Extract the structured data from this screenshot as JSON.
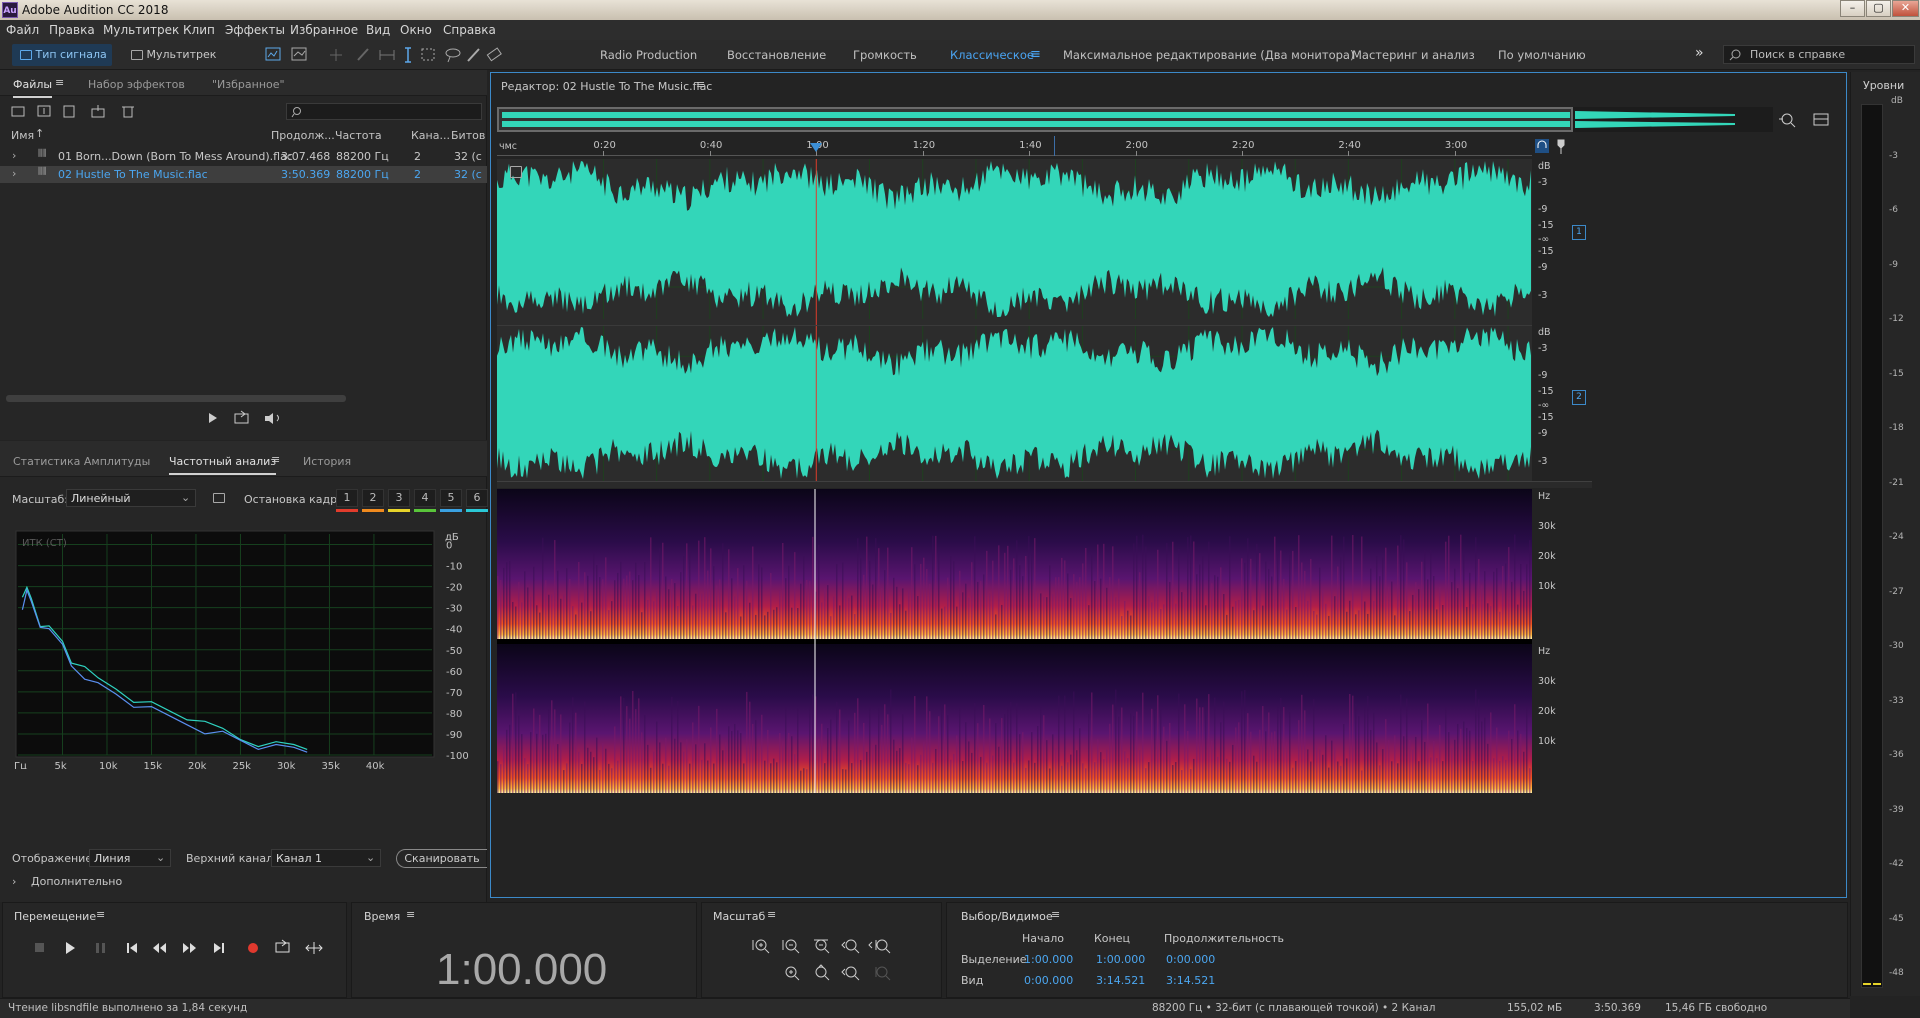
{
  "window": {
    "title": "Adobe Audition CC 2018",
    "app_icon": "Au"
  },
  "menu": [
    "Файл",
    "Правка",
    "Мультитрек",
    "Клип",
    "Эффекты",
    "Избранное",
    "Вид",
    "Окно",
    "Справка"
  ],
  "toolbar": {
    "waveform_label": "Тип сигнала",
    "multitrack_label": "Мультитрек",
    "workspaces": [
      "Radio Production",
      "Восстановление",
      "Громкость",
      "Классическое",
      "Максимальное редактирование (Два монитора)",
      "Мастеринг и анализ",
      "По умолчанию"
    ],
    "active_workspace": "Классическое",
    "help_search_placeholder": "Поиск в справке"
  },
  "files_panel": {
    "tabs": [
      "Файлы",
      "Набор эффектов",
      "\"Избранное\""
    ],
    "search_placeholder": "",
    "columns": [
      "Имя",
      "Продолж...",
      "Частота",
      "Кана...",
      "Битов"
    ],
    "rows": [
      {
        "name": "01 Born...Down (Born To Mess Around).flac",
        "duration": "3:07.468",
        "rate": "88200 Гц",
        "channels": "2",
        "bits": "32 (с"
      },
      {
        "name": "02 Hustle To The Music.flac",
        "duration": "3:50.369",
        "rate": "88200 Гц",
        "channels": "2",
        "bits": "32 (с"
      }
    ]
  },
  "analysis_panel": {
    "tabs": [
      "Статистика Амплитуды",
      "Частотный анализ",
      "История"
    ],
    "scale_label": "Масштаб:",
    "scale_value": "Линейный",
    "freeze_label": "Остановка кадра:",
    "freeze_slots": [
      "1",
      "2",
      "3",
      "4",
      "5",
      "6"
    ],
    "freeze_colors": [
      "#e23c2c",
      "#f08a1e",
      "#e6d32a",
      "#59c43a",
      "#3aa0e0",
      "#2bc8d6"
    ],
    "graph_label": "ИТК (СТ)",
    "db_unit": "дБ",
    "db_ticks": [
      "0",
      "-10",
      "-20",
      "-30",
      "-40",
      "-50",
      "-60",
      "-70",
      "-80",
      "-90",
      "-100"
    ],
    "freq_ticks": [
      "Гц",
      "5k",
      "10k",
      "15k",
      "20k",
      "25k",
      "30k",
      "35k",
      "40k"
    ],
    "display_label": "Отображение:",
    "display_value": "Линия",
    "top_channel_label": "Верхний канал:",
    "top_channel_value": "Канал 1",
    "scan_button": "Сканировать",
    "advanced_label": "Дополнительно"
  },
  "editor": {
    "title": "Редактор: 02 Hustle To The Music.flac",
    "time_unit": "чмс",
    "time_ticks": [
      "0:20",
      "0:40",
      "1:00",
      "1:20",
      "1:40",
      "2:00",
      "2:20",
      "2:40",
      "3:00"
    ],
    "playhead_position_s": 60,
    "total_duration_s": 194.5,
    "wave_db_labels": [
      "dB",
      "-3",
      "-9",
      "-15",
      "-∞",
      "-15",
      "-9",
      "-3"
    ],
    "channel_badges": [
      "1",
      "2"
    ],
    "spectral_labels": [
      "Hz",
      "30k",
      "20k",
      "10k"
    ]
  },
  "levels_panel": {
    "title": "Уровни",
    "ticks": [
      "dB",
      "-3",
      "-6",
      "-9",
      "-12",
      "-15",
      "-18",
      "-21",
      "-24",
      "-27",
      "-30",
      "-33",
      "-36",
      "-39",
      "-42",
      "-45",
      "-48"
    ]
  },
  "transport": {
    "title": "Перемещение"
  },
  "time_panel": {
    "title": "Время",
    "value": "1:00.000"
  },
  "zoom_panel": {
    "title": "Масштаб"
  },
  "selection_panel": {
    "title": "Выбор/Видимое",
    "headers": [
      "Начало",
      "Конец",
      "Продолжительность"
    ],
    "selection": {
      "label": "Выделение",
      "start": "1:00.000",
      "end": "1:00.000",
      "duration": "0:00.000"
    },
    "view": {
      "label": "Вид",
      "start": "0:00.000",
      "end": "3:14.521",
      "duration": "3:14.521"
    }
  },
  "status": {
    "left": "Чтение libsndfile выполнено за 1,84 секунд",
    "format": "88200 Гц • 32-бит (с плавающей точкой) • 2 Канал",
    "size": "155,02 мБ",
    "duration": "3:50.369",
    "free": "15,46 ГБ свободно"
  },
  "colors": {
    "waveform": "#33d6b9",
    "accent": "#3c8fd6",
    "playhead": "#e0392e",
    "spectrum_a": "#2fd2c0",
    "spectrum_b": "#5a8ff0"
  },
  "freq_chart": {
    "chart_data": {
      "type": "line",
      "title": "",
      "xlabel": "Гц",
      "ylabel": "дБ",
      "xlim": [
        0,
        44100
      ],
      "ylim": [
        -100,
        5
      ],
      "series": [
        {
          "x": [
            500,
            1000,
            1500,
            2500,
            3500,
            5000,
            6000,
            7500,
            9000,
            11000,
            13000,
            15000,
            17000,
            19000,
            21000,
            23000,
            25000,
            27000,
            29000,
            31000,
            32500
          ],
          "values": [
            -27,
            -21,
            -25,
            -37,
            -40,
            -46,
            -55,
            -60,
            -64,
            -68,
            -73,
            -76,
            -79,
            -82,
            -86,
            -88,
            -92,
            -94,
            -95,
            -95,
            -96
          ]
        },
        {
          "x": [
            500,
            1000,
            1500,
            2500,
            3500,
            5000,
            6000,
            7500,
            9000,
            11000,
            13000,
            15000,
            17000,
            19000,
            21000,
            23000,
            25000,
            27000,
            29000,
            31000,
            32500
          ],
          "values": [
            -29,
            -23,
            -27,
            -38,
            -42,
            -48,
            -57,
            -62,
            -67,
            -71,
            -76,
            -79,
            -82,
            -85,
            -88,
            -90,
            -93,
            -96,
            -97,
            -97,
            -98
          ]
        }
      ]
    }
  }
}
